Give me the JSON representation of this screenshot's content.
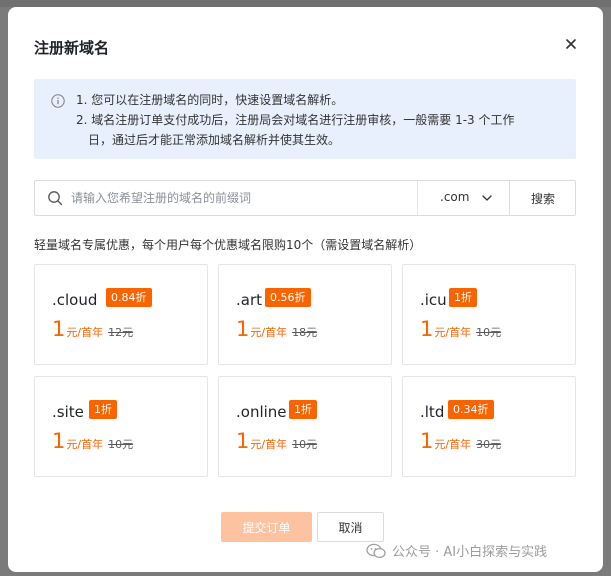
{
  "dialog": {
    "title": "注册新域名",
    "notice": {
      "line1": "1. 您可以在注册域名的同时，快速设置域名解析。",
      "line2": "2. 域名注册订单支付成功后，注册局会对域名进行注册审核，一般需要 1-3 个工作",
      "line3": "日，通过后才能正常添加域名解析并使其生效。"
    },
    "search": {
      "placeholder": "请输入您希望注册的域名的前缀词",
      "tld_selected": ".com",
      "button_label": "搜索"
    },
    "promo_text": "轻量域名专属优惠，每个用户每个优惠域名限购10个（需设置域名解析）",
    "cards": [
      {
        "name": ".cloud",
        "badge": "0.84折",
        "price": "1",
        "unit": "元/首年",
        "original": "12元"
      },
      {
        "name": ".art",
        "badge": "0.56折",
        "price": "1",
        "unit": "元/首年",
        "original": "18元"
      },
      {
        "name": ".icu",
        "badge": "1折",
        "price": "1",
        "unit": "元/首年",
        "original": "10元"
      },
      {
        "name": ".site",
        "badge": "1折",
        "price": "1",
        "unit": "元/首年",
        "original": "10元"
      },
      {
        "name": ".online",
        "badge": "1折",
        "price": "1",
        "unit": "元/首年",
        "original": "10元"
      },
      {
        "name": ".ltd",
        "badge": "0.34折",
        "price": "1",
        "unit": "元/首年",
        "original": "30元"
      }
    ],
    "buttons": {
      "submit": "提交订单",
      "cancel": "取消"
    }
  },
  "watermark": {
    "text": "公众号 · AI小白探索与实践"
  },
  "colors": {
    "accent": "#fa6400",
    "accent_disabled": "#fdc2a0",
    "notice_bg": "#e8f0fd"
  }
}
